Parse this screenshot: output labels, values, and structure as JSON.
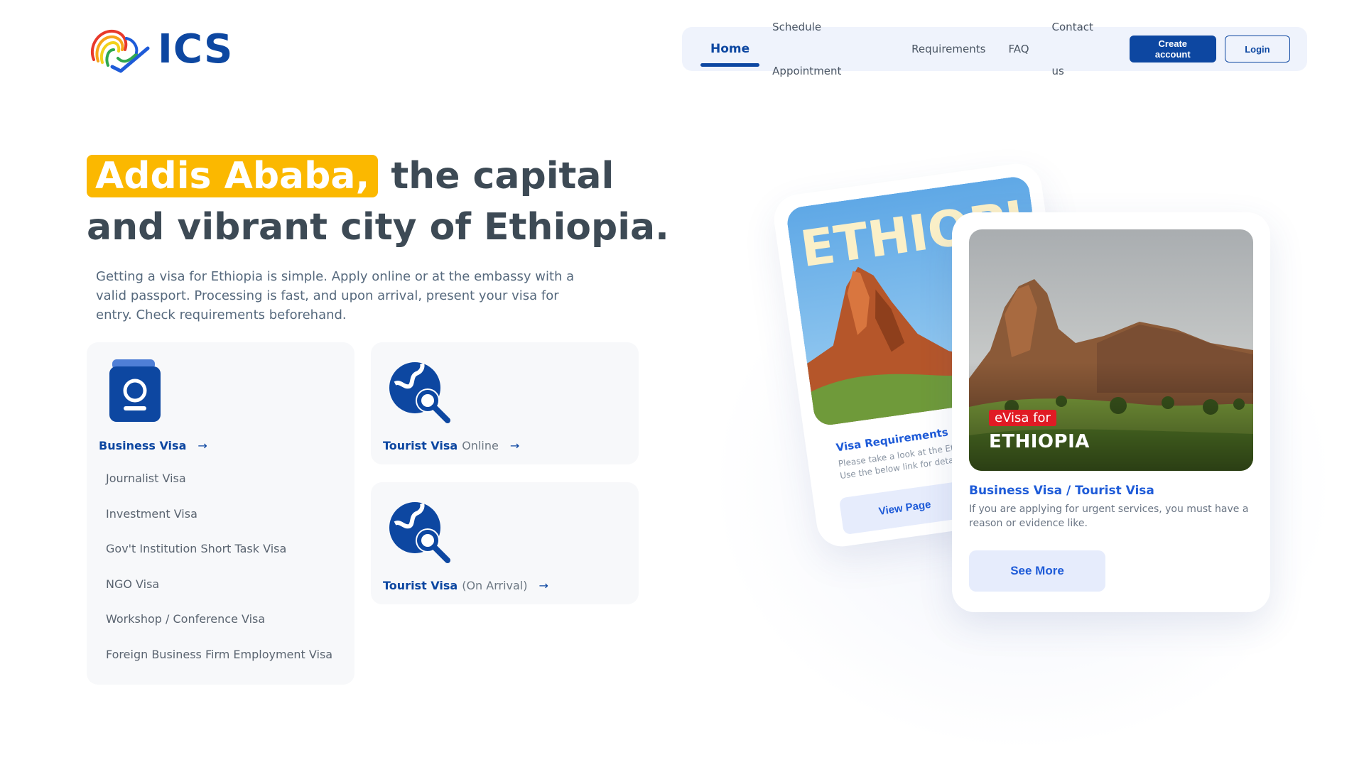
{
  "brand": {
    "name": "ICS"
  },
  "nav": {
    "items": [
      {
        "label": "Home",
        "active": true
      },
      {
        "label": "Schedule Appointment"
      },
      {
        "label": "Requirements"
      },
      {
        "label": "FAQ"
      },
      {
        "label": "Contact us"
      }
    ],
    "create_account": "Create account",
    "login": "Login"
  },
  "hero": {
    "highlight": "Addis Ababa,",
    "title_rest": "the capital and vibrant city of Ethiopia.",
    "subtitle": "Getting a visa for Ethiopia is simple. Apply online or at the embassy with a valid passport. Processing is fast, and upon arrival, present your visa for entry. Check requirements beforehand."
  },
  "visa_cards": {
    "business": {
      "title": "Business Visa",
      "sub_items": [
        "Journalist Visa",
        "Investment Visa",
        "Gov't Institution Short Task Visa",
        "NGO Visa",
        "Workshop / Conference Visa",
        "Foreign Business Firm Employment Visa"
      ]
    },
    "tourist_online": {
      "title": "Tourist Visa",
      "suffix": "Online"
    },
    "tourist_arrival": {
      "title": "Tourist Visa",
      "suffix": "(On Arrival)"
    }
  },
  "promo_back": {
    "image_word": "ETHIOPIA",
    "title": "Visa Requirements",
    "text_line1": "Please take a look at the Eth",
    "text_line2": "Use the below link for detail",
    "button": "View Page"
  },
  "promo_front": {
    "tag": "eVisa for",
    "tag_big": "ETHIOPIA",
    "title": "Business Visa / Tourist Visa",
    "text": "If you are applying for urgent services, you must have a reason or evidence like.",
    "button": "See More"
  },
  "colors": {
    "primary": "#0d47a1",
    "accent_yellow": "#fbb800",
    "link_blue": "#1e5bd8",
    "nav_bg": "#eff3fc",
    "card_bg": "#f7f8fa",
    "evisa_red": "#e01b24"
  },
  "icons": {
    "logo": "fingerprint-africa-logo",
    "business": "passport-icon",
    "tourist": "globe-search-icon",
    "arrow": "arrow-right-icon"
  }
}
